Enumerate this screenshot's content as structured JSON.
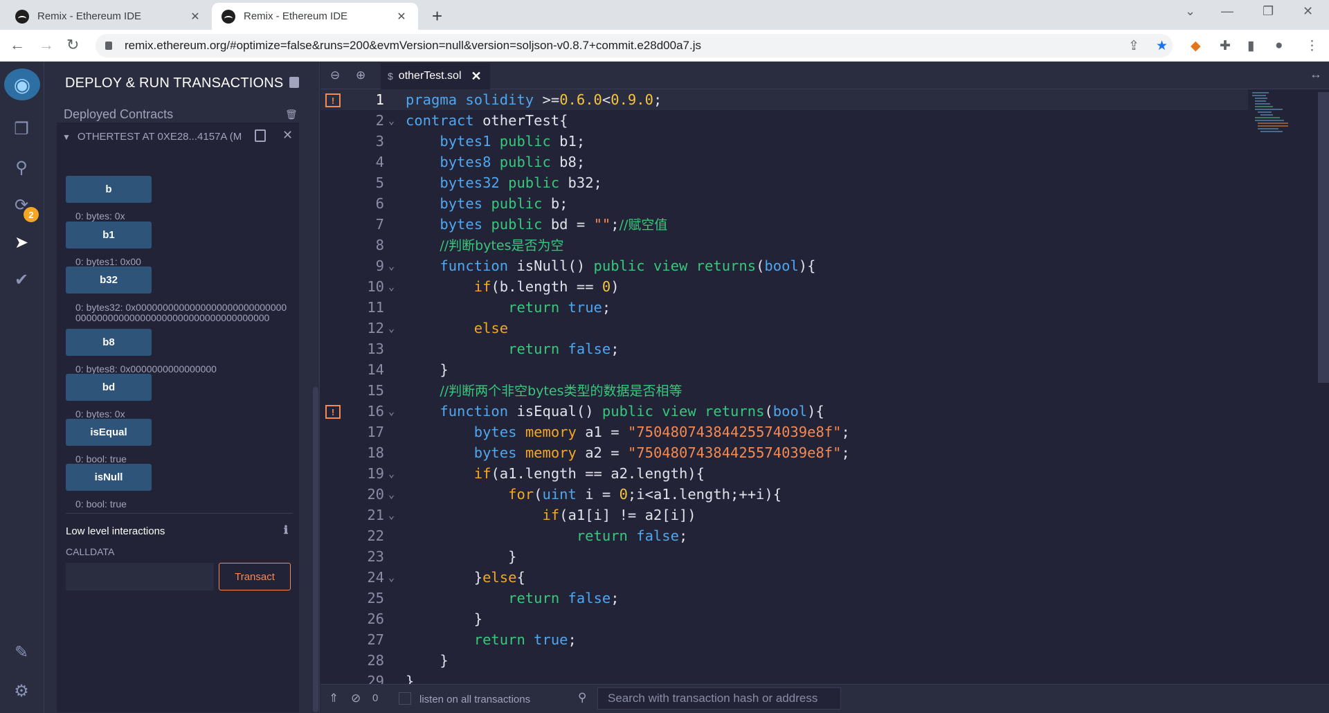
{
  "browser": {
    "tabs": [
      {
        "title": "Remix - Ethereum IDE",
        "close": "✕"
      },
      {
        "title": "Remix - Ethereum IDE",
        "close": "✕"
      }
    ],
    "new_tab": "+",
    "url": "remix.ethereum.org/#optimize=false&runs=200&evmVersion=null&version=soljson-v0.8.7+commit.e28d00a7.js"
  },
  "icon_panel": {
    "badge_count": "2"
  },
  "side_panel": {
    "title": "DEPLOY & RUN TRANSACTIONS",
    "deployed_label": "Deployed Contracts",
    "instance_title": "OTHERTEST AT 0XE28...4157A (M",
    "functions": [
      {
        "label": "b",
        "output": "0: bytes: 0x"
      },
      {
        "label": "b1",
        "output": "0: bytes1: 0x00"
      },
      {
        "label": "b32",
        "output": "0:  bytes32: 0x0000000000000000000000000000000000000000000000000000000000000000"
      },
      {
        "label": "b8",
        "output": "0: bytes8: 0x0000000000000000"
      },
      {
        "label": "bd",
        "output": "0: bytes: 0x"
      },
      {
        "label": "isEqual",
        "output": "0: bool: true"
      },
      {
        "label": "isNull",
        "output": "0: bool: true"
      }
    ],
    "low_level_title": "Low level interactions",
    "calldata_label": "CALLDATA",
    "transact_label": "Transact"
  },
  "editor": {
    "file_tab": "otherTest.sol",
    "current_line": 1,
    "warning_lines": [
      1,
      16
    ],
    "fold_lines": [
      2,
      9,
      10,
      12,
      16,
      19,
      20,
      21,
      24
    ]
  },
  "terminal": {
    "count": "0",
    "listen_label": "listen on all transactions",
    "search_placeholder": "Search with transaction hash or address"
  },
  "colors": {
    "background": "#222336",
    "panel": "#2a2c3f",
    "button": "#2e5579",
    "accent_orange": "#f58a53",
    "keyword_blue": "#4fa7f0",
    "keyword_green": "#37c87c"
  }
}
